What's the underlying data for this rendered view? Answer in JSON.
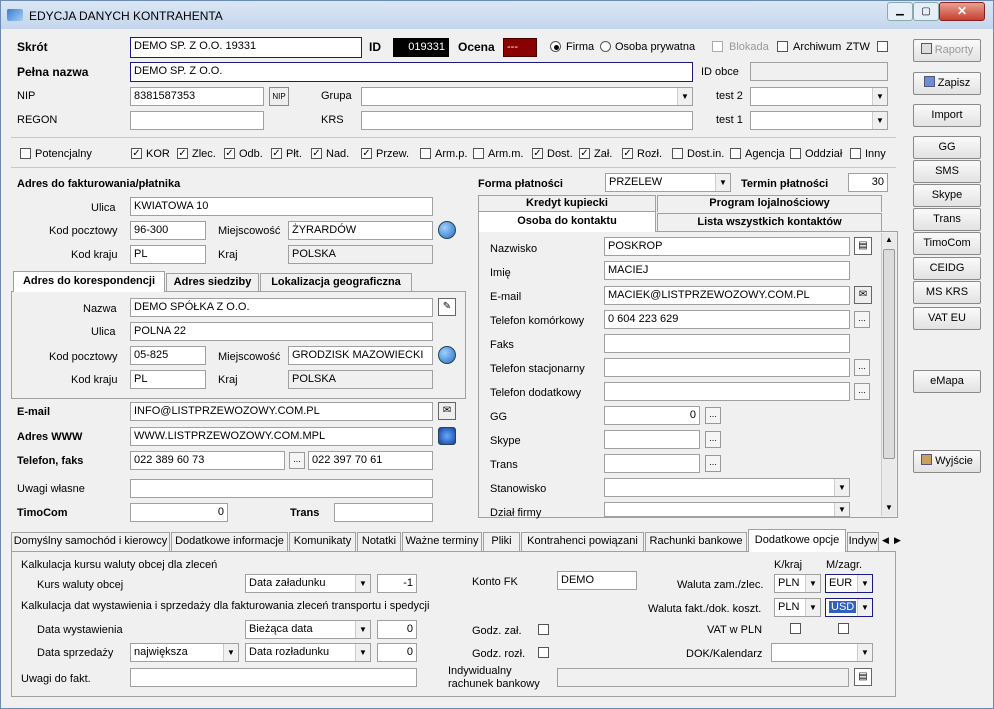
{
  "title": "EDYCJA DANYCH KONTRAHENTA",
  "header": {
    "skrot_label": "Skrót",
    "skrot_value": "DEMO SP. Z O.O.    19331",
    "id_label": "ID",
    "id_value": "019331",
    "ocena_label": "Ocena",
    "ocena_value": "---",
    "firma_label": "Firma",
    "osoba_label": "Osoba prywatna",
    "blokada_label": "Blokada",
    "archiwum_label": "Archiwum",
    "ztw_label": "ZTW",
    "pelna_label": "Pełna nazwa",
    "pelna_value": "DEMO SP. Z O.O.",
    "idobce_label": "ID obce",
    "nip_label": "NIP",
    "nip_value": "8381587353",
    "nip_btn": "NIP",
    "grupa_label": "Grupa",
    "test2_label": "test 2",
    "regon_label": "REGON",
    "krs_label": "KRS",
    "test1_label": "test 1"
  },
  "flags": [
    {
      "label": "Potencjalny",
      "checked": false
    },
    {
      "label": "KOR",
      "checked": true
    },
    {
      "label": "Zlec.",
      "checked": true
    },
    {
      "label": "Odb.",
      "checked": true
    },
    {
      "label": "Płt.",
      "checked": true
    },
    {
      "label": "Nad.",
      "checked": true
    },
    {
      "label": "Przew.",
      "checked": true
    },
    {
      "label": "Arm.p.",
      "checked": false
    },
    {
      "label": "Arm.m.",
      "checked": false
    },
    {
      "label": "Dost.",
      "checked": true
    },
    {
      "label": "Zał.",
      "checked": true
    },
    {
      "label": "Rozł.",
      "checked": true
    },
    {
      "label": "Dost.in.",
      "checked": false
    },
    {
      "label": "Agencja",
      "checked": false
    },
    {
      "label": "Oddział",
      "checked": false
    },
    {
      "label": "Inny",
      "checked": false
    }
  ],
  "billing": {
    "title": "Adres do fakturowania/płatnika",
    "ulica_label": "Ulica",
    "ulica": "KWIATOWA 10",
    "kod_label": "Kod pocztowy",
    "kod": "96-300",
    "miejsc_label": "Miejscowość",
    "miejsc": "ŻYRARDÓW",
    "kraj_kod_label": "Kod kraju",
    "kraj_kod": "PL",
    "kraj_label": "Kraj",
    "kraj": "POLSKA"
  },
  "addr_tabs": [
    "Adres do korespondencji",
    "Adres siedziby",
    "Lokalizacja geograficzna"
  ],
  "corr": {
    "nazwa_label": "Nazwa",
    "nazwa": "DEMO SPÓŁKA Z O.O.",
    "ulica_label": "Ulica",
    "ulica": "POLNA 22",
    "kod_label": "Kod pocztowy",
    "kod": "05-825",
    "miejsc_label": "Miejscowość",
    "miejsc": "GRODZISK MAZOWIECKI",
    "kraj_kod_label": "Kod kraju",
    "kraj_kod": "PL",
    "kraj_label": "Kraj",
    "kraj": "POLSKA"
  },
  "contact": {
    "email_label": "E-mail",
    "email": "INFO@LISTPRZEWOZOWY.COM.PL",
    "www_label": "Adres WWW",
    "www": "WWW.LISTPRZEWOZOWY.COM.MPL",
    "tel_label": "Telefon, faks",
    "tel": "022 389 60 73",
    "fax": "022 397 70 61",
    "uwagi_label": "Uwagi własne",
    "timocom_label": "TimoCom",
    "timocom": "0",
    "trans_label": "Trans"
  },
  "payment": {
    "forma_label": "Forma płatności",
    "forma": "PRZELEW",
    "termin_label": "Termin płatności",
    "termin": "30"
  },
  "right_tabs": {
    "kredyt": "Kredyt kupiecki",
    "program": "Program lojalnościowy",
    "osoba": "Osoba do kontaktu",
    "lista": "Lista wszystkich kontaktów"
  },
  "person": {
    "nazwisko_label": "Nazwisko",
    "nazwisko": "POSKROP",
    "imie_label": "Imię",
    "imie": "MACIEJ",
    "email_label": "E-mail",
    "email": "MACIEK@LISTPRZEWOZOWY.COM.PL",
    "kom_label": "Telefon komórkowy",
    "kom": "0 604 223 629",
    "faks_label": "Faks",
    "stac_label": "Telefon stacjonarny",
    "dod_label": "Telefon dodatkowy",
    "gg_label": "GG",
    "gg": "0",
    "skype_label": "Skype",
    "trans_label": "Trans",
    "stan_label": "Stanowisko",
    "dzial_label": "Dział firmy"
  },
  "side_buttons": [
    "Raporty",
    "Zapisz",
    "Import",
    "GG",
    "SMS",
    "Skype",
    "Trans",
    "TimoCom",
    "CEIDG",
    "MS KRS",
    "VAT EU",
    "eMapa",
    "Wyjście"
  ],
  "bottom_tabs": [
    "Domyślny samochód i kierowcy",
    "Dodatkowe informacje",
    "Komunikaty",
    "Notatki",
    "Ważne terminy",
    "Pliki",
    "Kontrahenci powiązani",
    "Rachunki bankowe",
    "Dodatkowe opcje",
    "Indyw"
  ],
  "opts": {
    "kurs_title": "Kalkulacja kursu waluty obcej dla zleceń",
    "kurs_label": "Kurs waluty obcej",
    "kurs_sel": "Data załadunku",
    "kurs_val": "-1",
    "kalk_title": "Kalkulacja dat wystawienia i sprzedaży dla fakturowania zleceń transportu i spedycji",
    "wyst_label": "Data wystawienia",
    "wyst_sel": "Bieżąca data",
    "wyst_val": "0",
    "sprz_label": "Data sprzedaży",
    "sprz_sel1": "największa",
    "sprz_sel2": "Data rozładunku",
    "sprz_val": "0",
    "uwagi_label": "Uwagi do fakt.",
    "konto_label": "Konto FK",
    "konto": "DEMO",
    "godz_zal": "Godz. zał.",
    "godz_rozl": "Godz. rozł.",
    "indyw_label1": "Indywidualny",
    "indyw_label2": "rachunek bankowy",
    "kkraj_label": "K/kraj",
    "mzagr_label": "M/zagr.",
    "waluta_zam_label": "Waluta zam./zlec.",
    "waluta_zam_k": "PLN",
    "waluta_zam_m": "EUR",
    "waluta_fakt_label": "Waluta fakt./dok. koszt.",
    "waluta_fakt_k": "PLN",
    "waluta_fakt_m": "USD",
    "vat_label": "VAT w PLN",
    "dok_label": "DOK/Kalendarz"
  }
}
